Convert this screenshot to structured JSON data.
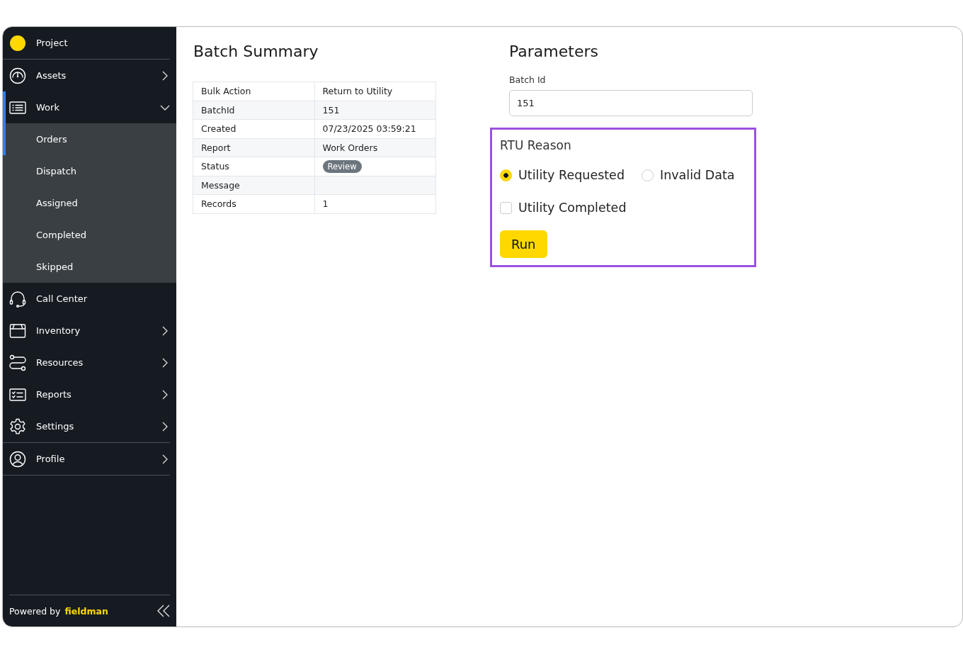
{
  "sidebar": {
    "sections": [
      [
        {
          "label": "Project"
        }
      ],
      [
        {
          "label": "Assets",
          "expanded": false
        },
        {
          "label": "Work",
          "expanded": true,
          "children": [
            {
              "label": "Orders",
              "selected": true
            },
            {
              "label": "Dispatch",
              "selected": false
            },
            {
              "label": "Assigned",
              "selected": false
            },
            {
              "label": "Completed",
              "selected": false
            },
            {
              "label": "Skipped",
              "selected": false
            }
          ]
        },
        {
          "label": "Call Center"
        },
        {
          "label": "Inventory",
          "expanded": false
        },
        {
          "label": "Resources",
          "expanded": false
        },
        {
          "label": "Reports",
          "expanded": false
        },
        {
          "label": "Settings",
          "expanded": false
        }
      ],
      [
        {
          "label": "Profile",
          "expanded": false
        }
      ]
    ],
    "footer": {
      "powered_by": "Powered by",
      "brand": "fieldman"
    }
  },
  "summary": {
    "title": "Batch Summary",
    "rows": [
      {
        "kind": "text",
        "label": "Bulk Action",
        "value": "Return to Utility"
      },
      {
        "kind": "text",
        "label": "BatchId",
        "value": "151"
      },
      {
        "kind": "text",
        "label": "Created",
        "value": "07/23/2025 03:59:21"
      },
      {
        "kind": "text",
        "label": "Report",
        "value": "Work Orders"
      },
      {
        "kind": "badge",
        "label": "Status",
        "value": "Review"
      },
      {
        "kind": "text",
        "label": "Message",
        "value": ""
      },
      {
        "kind": "text",
        "label": "Records",
        "value": "1"
      }
    ]
  },
  "parameters": {
    "title": "Parameters",
    "batch_id": {
      "label": "Batch Id",
      "value": "151"
    },
    "reason": {
      "title": "RTU Reason",
      "options": [
        {
          "kind": "radio",
          "label": "Utility Requested",
          "selected": true
        },
        {
          "kind": "radio",
          "label": "Invalid Data",
          "selected": false
        },
        {
          "kind": "checkbox",
          "label": "Utility Completed",
          "checked": false
        }
      ]
    },
    "run_button": "Run"
  }
}
